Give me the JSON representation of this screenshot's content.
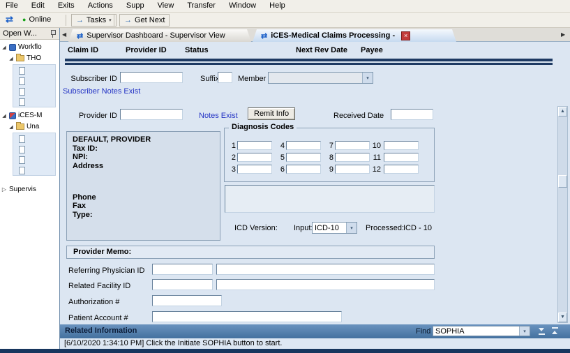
{
  "colors": {
    "accent_navy": "#1e3a63",
    "link_blue": "#2333c4",
    "related_bar_blue": "#44719f",
    "online_green": "#17a317",
    "close_red": "#c23b3b"
  },
  "icons": {
    "app": "⇄",
    "arrow": "→",
    "dropdown": "▾",
    "online_dot": "●",
    "tab_prev": "◀",
    "tab_next": "▶",
    "close": "×",
    "tree_expanded": "◢",
    "tree_collapsed": "▷",
    "scroll_up": "▲",
    "scroll_down": "▼"
  },
  "menu": {
    "items": [
      "File",
      "Edit",
      "Exits",
      "Actions",
      "Supp",
      "View",
      "Transfer",
      "Window",
      "Help"
    ]
  },
  "toolbar": {
    "online_label": "Online",
    "tasks_label": "Tasks",
    "get_next_label": "Get Next"
  },
  "sidebar": {
    "title": "Open W...",
    "nodes": {
      "workflow": "Workflo",
      "tho": "THO",
      "ices": "iCES-M",
      "una": "Una",
      "supervisor": "Supervis"
    }
  },
  "tabs": [
    {
      "label": "Supervisor Dashboard - Supervisor View"
    },
    {
      "label": "iCES-Medical Claims Processing -"
    }
  ],
  "grid": {
    "headers": [
      "Claim ID",
      "Provider ID",
      "Status",
      "Next Rev Date",
      "Payee"
    ]
  },
  "form": {
    "subscriber_id_label": "Subscriber ID",
    "suffix_label": "Suffix",
    "member_label": "Member",
    "subscriber_notes_link": "Subscriber Notes Exist",
    "provider_id_label": "Provider ID",
    "notes_exist_link": "Notes Exist",
    "remit_info_button": "Remit Info",
    "received_date_label": "Received Date",
    "provider_box": {
      "name": "DEFAULT, PROVIDER",
      "tax_id": "Tax ID:",
      "npi": "NPI:",
      "address": "Address",
      "phone": "Phone",
      "fax": "Fax",
      "type": "Type:"
    },
    "diagnosis": {
      "title": "Diagnosis Codes",
      "numbers": [
        "1",
        "2",
        "3",
        "4",
        "5",
        "6",
        "7",
        "8",
        "9",
        "10",
        "11",
        "12"
      ]
    },
    "icd": {
      "version_label": "ICD Version:",
      "input_label": "Input:",
      "input_value": "ICD-10",
      "processed_label": "Processed:",
      "processed_value": "ICD - 10"
    },
    "provider_memo_title": "Provider Memo:",
    "referring_physician_label": "Referring Physician ID",
    "related_facility_label": "Related Facility ID",
    "authorization_label": "Authorization #",
    "patient_account_label": "Patient Account #"
  },
  "related": {
    "title": "Related Information",
    "find_label": "Find",
    "find_value": "SOPHIA"
  },
  "log": {
    "message": "[6/10/2020 1:34:10 PM] Click the Initiate SOPHIA button to start."
  }
}
